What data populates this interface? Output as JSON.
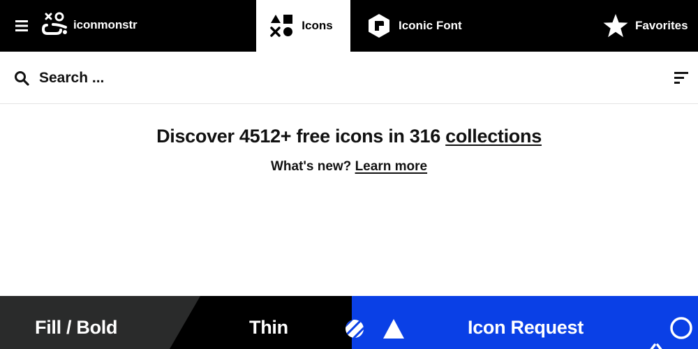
{
  "header": {
    "logo_text": "iconmonstr",
    "nav": {
      "icons_label": "Icons",
      "iconic_font_label": "Iconic Font",
      "favorites_label": "Favorites"
    }
  },
  "search": {
    "placeholder": "Search ...",
    "value": ""
  },
  "hero": {
    "title_prefix": "Discover 4512+ free icons in 316",
    "title_link": "collections",
    "subtitle_prefix": "What's new?",
    "subtitle_link": "Learn more"
  },
  "categories": {
    "fill_bold_label": "Fill / Bold",
    "thin_label": "Thin",
    "request_label": "Icon Request"
  },
  "colors": {
    "header_bg": "#000000",
    "fill_panel": "#2a2b2b",
    "thin_panel": "#000000",
    "request_panel": "#0a40e6"
  },
  "icons": {
    "menu": "hamburger-icon",
    "logo": "iconmonstr-logo-icon",
    "icons_tab": "shapes-icon",
    "iconic_font_tab": "font-hexagon-icon",
    "favorites_tab": "star-icon",
    "search": "search-icon",
    "filter": "filter-lines-icon"
  }
}
